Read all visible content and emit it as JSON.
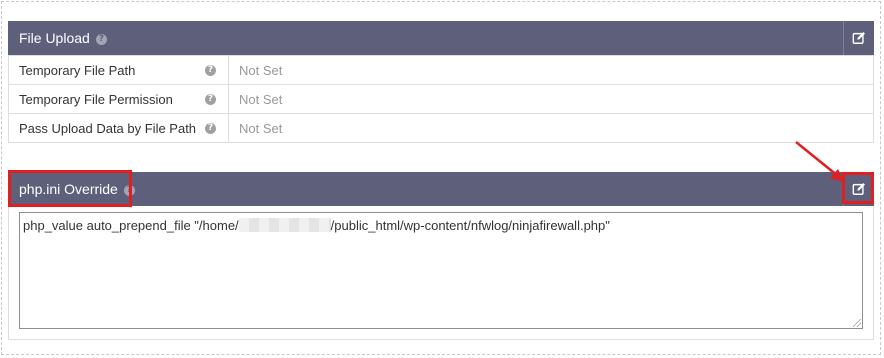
{
  "file_upload": {
    "title": "File Upload",
    "help_icon": "question-circle-icon",
    "edit_icon": "edit-icon",
    "rows": [
      {
        "label": "Temporary File Path",
        "value": "Not Set"
      },
      {
        "label": "Temporary File Permission",
        "value": "Not Set"
      },
      {
        "label": "Pass Upload Data by File Path",
        "value": "Not Set"
      }
    ]
  },
  "php_ini": {
    "title": "php.ini Override",
    "help_icon": "question-circle-icon",
    "edit_icon": "edit-icon",
    "textarea_prefix": "php_value auto_prepend_file \"/home/",
    "textarea_suffix": "/public_html/wp-content/nfwlog/ninjafirewall.php\""
  },
  "annotations": {
    "highlight_color": "#e02020",
    "header_color": "#5e5f7a"
  }
}
